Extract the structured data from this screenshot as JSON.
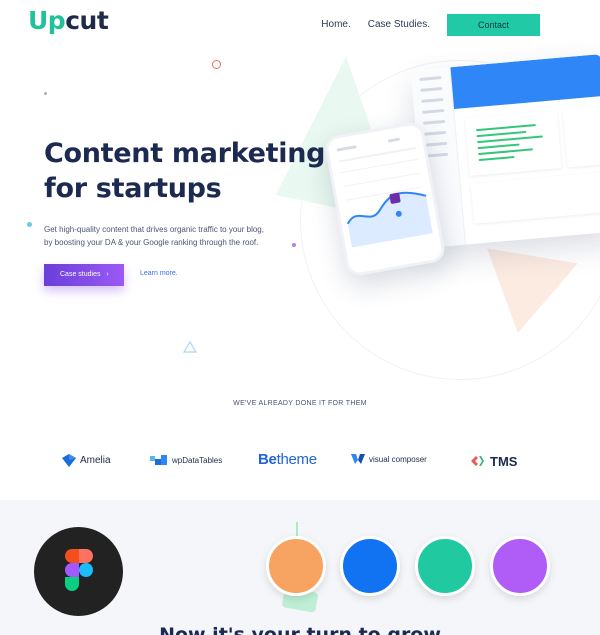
{
  "header": {
    "logo_up": "Up",
    "logo_cut": "cut",
    "nav": [
      "Home.",
      "Case Studies."
    ],
    "cta_label": "Contact"
  },
  "hero": {
    "title_line1": "Content marketing",
    "title_line2": "for startups",
    "subtitle_line1": "Get high-quality content that drives organic traffic to your blog,",
    "subtitle_line2": "by boosting your DA & your Google ranking through the roof.",
    "primary_button": "Case studies",
    "primary_button_arrow": "›",
    "secondary_link": "Learn more."
  },
  "clients": {
    "title": "WE'VE ALREADY DONE IT FOR THEM",
    "logos": [
      "Amelia",
      "wpDataTables",
      "Betheme",
      "visual composer",
      "TMS"
    ],
    "betheme_be": "Be",
    "betheme_rest": "theme"
  },
  "palette": {
    "colors": [
      "#f7a462",
      "#1273f2",
      "#21c9a0",
      "#b05cf6"
    ]
  },
  "bottom": {
    "heading": "Now it's your turn to grow"
  },
  "icons": [
    "figma-icon",
    "amelia-icon",
    "wpdatatables-icon",
    "visual-composer-icon",
    "tms-icon"
  ]
}
